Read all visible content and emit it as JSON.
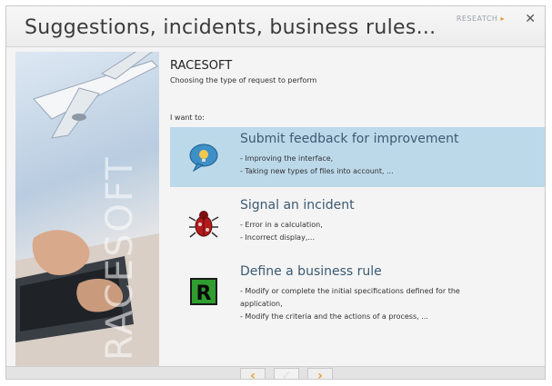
{
  "window": {
    "title": "Suggestions, incidents, business rules...",
    "brand": "RESEATCH",
    "close_glyph": "✕"
  },
  "header": {
    "app_name": "RACESOFT",
    "subtitle": "Choosing the type of request to perform"
  },
  "prompt": "I want to:",
  "sidebar": {
    "watermark": "RACESOFT"
  },
  "options": [
    {
      "title": "Submit feedback for improvement",
      "lines": [
        "- Improving the interface,",
        "- Taking new types of files into account, ..."
      ],
      "icon": "feedback-bubble-icon",
      "selected": true
    },
    {
      "title": "Signal an incident",
      "lines": [
        "- Error in a calculation,",
        "- Incorrect display,..."
      ],
      "icon": "bug-icon",
      "selected": false
    },
    {
      "title": "Define a business rule",
      "lines": [
        "- Modify or complete the initial specifications defined for the",
        "application,",
        "- Modify the criteria and the actions of a process, ..."
      ],
      "icon": "rule-r-icon",
      "selected": false
    }
  ],
  "nav": {
    "prev": "‹",
    "ok": "✓",
    "next": "›"
  },
  "colors": {
    "selection": "#bcd9ea",
    "option_title": "#3c5a72",
    "nav_arrow": "#e0a030"
  }
}
